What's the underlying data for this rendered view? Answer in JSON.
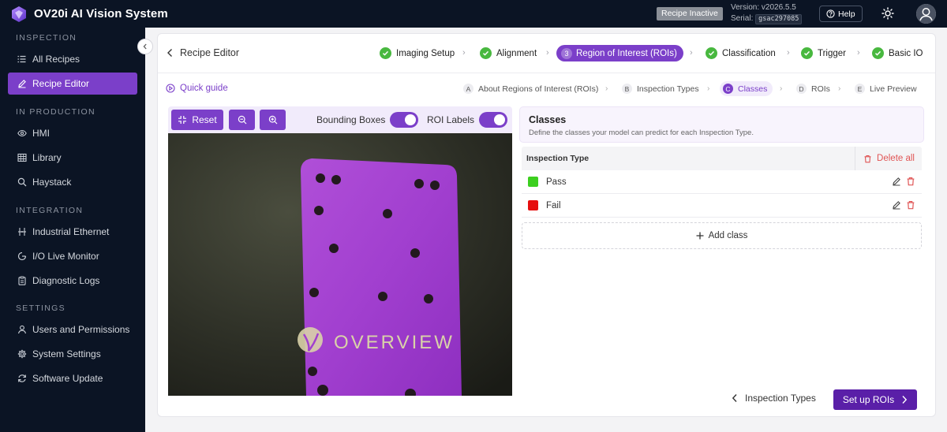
{
  "app": {
    "title": "OV20i AI Vision System"
  },
  "header": {
    "status_badge": "Recipe Inactive",
    "version": "Version: v2026.5.5",
    "serial_label": "Serial:",
    "serial_value": "gsac297085",
    "help_label": "Help"
  },
  "sidebar": {
    "sections": [
      {
        "title": "INSPECTION",
        "items": [
          {
            "label": "All Recipes",
            "icon": "list-icon"
          },
          {
            "label": "Recipe Editor",
            "icon": "pencil-icon",
            "active": true
          }
        ]
      },
      {
        "title": "IN PRODUCTION",
        "items": [
          {
            "label": "HMI",
            "icon": "eye-icon"
          },
          {
            "label": "Library",
            "icon": "library-grid-icon"
          },
          {
            "label": "Haystack",
            "icon": "search-icon"
          }
        ]
      },
      {
        "title": "INTEGRATION",
        "items": [
          {
            "label": "Industrial Ethernet",
            "icon": "network-icon"
          },
          {
            "label": "I/O Live Monitor",
            "icon": "gauge-icon"
          },
          {
            "label": "Diagnostic Logs",
            "icon": "clipboard-icon"
          }
        ]
      },
      {
        "title": "SETTINGS",
        "items": [
          {
            "label": "Users and Permissions",
            "icon": "user-icon"
          },
          {
            "label": "System Settings",
            "icon": "gear-icon"
          },
          {
            "label": "Software Update",
            "icon": "refresh-icon"
          }
        ]
      }
    ]
  },
  "editor": {
    "back_label": "Recipe Editor",
    "steps": [
      {
        "label": "Imaging Setup",
        "state": "done"
      },
      {
        "label": "Alignment",
        "state": "done"
      },
      {
        "number": "3",
        "label": "Region of Interest (ROIs)",
        "state": "current"
      },
      {
        "label": "Classification",
        "state": "done"
      },
      {
        "label": "Trigger",
        "state": "done"
      },
      {
        "label": "Basic IO",
        "state": "done"
      }
    ],
    "quick_guide": "Quick guide",
    "substeps": [
      {
        "letter": "A",
        "label": "About Regions of Interest (ROIs)"
      },
      {
        "letter": "B",
        "label": "Inspection Types"
      },
      {
        "letter": "C",
        "label": "Classes",
        "current": true
      },
      {
        "letter": "D",
        "label": "ROIs"
      },
      {
        "letter": "E",
        "label": "Live Preview"
      }
    ]
  },
  "viewer": {
    "reset_label": "Reset",
    "bounding_boxes_label": "Bounding Boxes",
    "bounding_boxes_on": true,
    "roi_labels_label": "ROI Labels",
    "roi_labels_on": true,
    "part_text": "OVERVIEW"
  },
  "classes": {
    "title": "Classes",
    "description": "Define the classes your model can predict for each Inspection Type.",
    "column_header": "Inspection Type",
    "delete_all_label": "Delete all",
    "items": [
      {
        "name": "Pass",
        "color": "#3ccf1f"
      },
      {
        "name": "Fail",
        "color": "#e60f0f"
      }
    ],
    "add_label": "Add class"
  },
  "footer": {
    "prev_label": "Inspection Types",
    "next_label": "Set up ROIs"
  },
  "colors": {
    "accent": "#7b3fc9",
    "sidebar_bg": "#0b1424",
    "success": "#48b83f",
    "danger": "#e05555"
  }
}
